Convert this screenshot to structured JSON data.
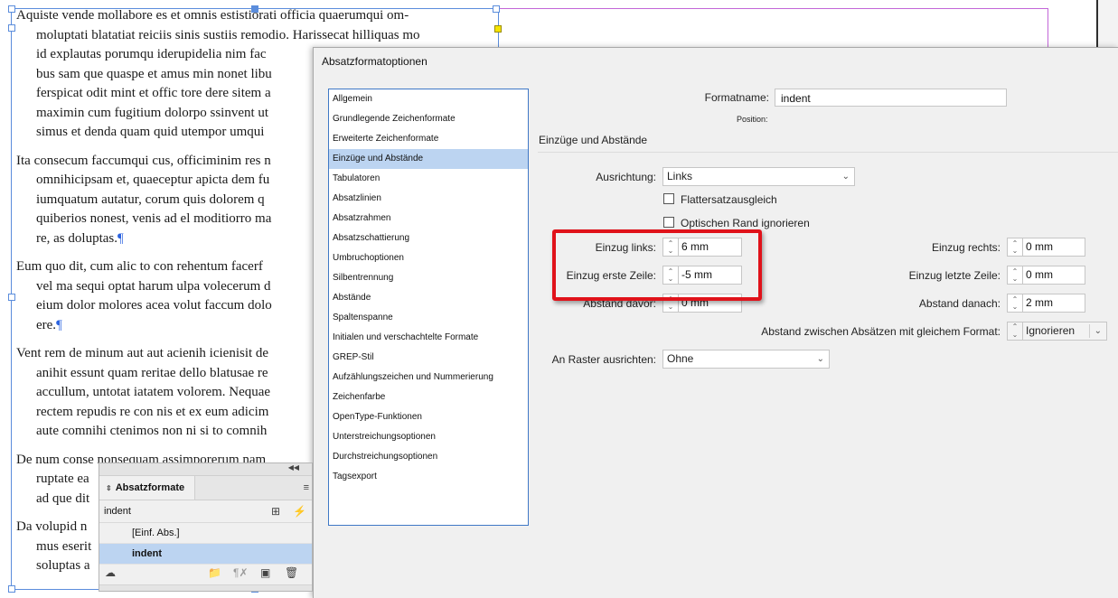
{
  "document": {
    "paragraphs": [
      {
        "lines": [
          "Aquiste vende mollabore es et omnis estistiorati officia quaerumqui om-",
          "moluptati blatatiat reiciis sinis sustiis remodio. Harissecat hilliquas mo",
          "id explautas porumqu iderupidelia nim fac",
          "bus sam que quaspe et amus min nonet libu",
          "ferspicat odit mint et offic tore dere sitem a",
          "maximin cum fugitium dolorpo ssinvent ut",
          "simus et denda quam quid utempor umqui"
        ],
        "pilcrow": ""
      },
      {
        "lines": [
          "Ita consecum faccumqui cus, officiminim res n",
          "omnihicipsam et, quaeceptur apicta dem fu",
          "iumquatum autatur, corum quis dolorem q",
          "quiberios nonest, venis ad el moditiorro ma",
          "re, as doluptas."
        ],
        "pilcrow": "¶"
      },
      {
        "lines": [
          "Eum quo dit, cum alic to con rehentum facerf",
          "vel ma sequi optat harum ulpa volecerum d",
          "eium dolor molores acea volut faccum dolo",
          "ere."
        ],
        "pilcrow": "¶"
      },
      {
        "lines": [
          "Vent rem de minum aut aut acienih icienisit de",
          "anihit essunt quam reritae dello blatusae re",
          "accullum, untotat iatatem volorem. Nequae",
          "rectem repudis re con nis et ex eum adicim",
          "aute comnihi ctenimos non ni si to comnih"
        ],
        "pilcrow": ""
      },
      {
        "lines": [
          "De num conse nonsequam assimporerum nam",
          "ruptate ea",
          "ad que dit"
        ],
        "pilcrow": ""
      },
      {
        "lines": [
          "Da volupid n",
          "mus eserit",
          "soluptas a"
        ],
        "pilcrow": ""
      }
    ]
  },
  "dialog": {
    "title": "Absatzformatoptionen",
    "categories": [
      "Allgemein",
      "Grundlegende Zeichenformate",
      "Erweiterte Zeichenformate",
      "Einzüge und Abstände",
      "Tabulatoren",
      "Absatzlinien",
      "Absatzrahmen",
      "Absatzschattierung",
      "Umbruchoptionen",
      "Silbentrennung",
      "Abstände",
      "Spaltenspanne",
      "Initialen und verschachtelte Formate",
      "GREP-Stil",
      "Aufzählungszeichen und Nummerierung",
      "Zeichenfarbe",
      "OpenType-Funktionen",
      "Unterstreichungsoptionen",
      "Durchstreichungsoptionen",
      "Tagsexport"
    ],
    "selected_category_index": 3,
    "formatname_label": "Formatname:",
    "formatname_value": "indent",
    "position_label": "Position:",
    "section_title": "Einzüge und Abstände",
    "alignment_label": "Ausrichtung:",
    "alignment_value": "Links",
    "flattersatz_label": "Flattersatzausgleich",
    "optischer_rand_label": "Optischen Rand ignorieren",
    "einzug_links_label": "Einzug links:",
    "einzug_links_value": "6 mm",
    "einzug_erste_label": "Einzug erste Zeile:",
    "einzug_erste_value": "-5 mm",
    "abstand_davor_label": "Abstand davor:",
    "abstand_davor_value": "0 mm",
    "einzug_rechts_label": "Einzug rechts:",
    "einzug_rechts_value": "0 mm",
    "einzug_letzte_label": "Einzug letzte Zeile:",
    "einzug_letzte_value": "0 mm",
    "abstand_danach_label": "Abstand danach:",
    "abstand_danach_value": "2 mm",
    "abstand_gleich_label": "Abstand zwischen Absätzen mit gleichem Format:",
    "abstand_gleich_value": "Ignorieren",
    "raster_label": "An Raster ausrichten:",
    "raster_value": "Ohne"
  },
  "panel": {
    "title": "Absatzformate",
    "current_style": "indent",
    "styles": [
      "[Einf. Abs.]",
      "indent"
    ],
    "selected_style_index": 1
  },
  "colors": {
    "highlight": "#e0121a",
    "selection": "#bcd4f1",
    "frame": "#5b8ddc"
  }
}
